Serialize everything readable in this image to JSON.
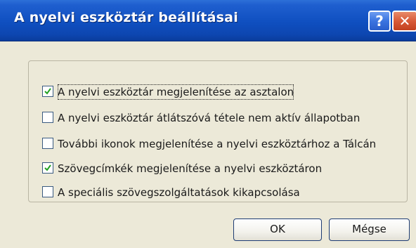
{
  "window": {
    "title": "A nyelvi eszköztár beállításai",
    "help_glyph": "?",
    "close_glyph": "✕"
  },
  "options": [
    {
      "label": "A nyelvi eszköztár megjelenítése az asztalon",
      "checked": true,
      "focused": true
    },
    {
      "label": "A nyelvi eszköztár átlátszóvá tétele nem aktív állapotban",
      "checked": false
    },
    {
      "label": "További ikonok megjelenítése a nyelvi eszköztárhoz a Tálcán",
      "checked": false
    },
    {
      "label": "Szövegcímkék megjelenítése a nyelvi eszköztáron",
      "checked": true
    },
    {
      "label": "A speciális szövegszolgáltatások kikapcsolása",
      "checked": false
    }
  ],
  "buttons": {
    "ok": "OK",
    "cancel": "Mégse"
  },
  "colors": {
    "titlebar": "#0f4fc0",
    "dialog_bg": "#ece9d8",
    "checkbox_border": "#3a5a80",
    "check_mark": "#21a121"
  }
}
